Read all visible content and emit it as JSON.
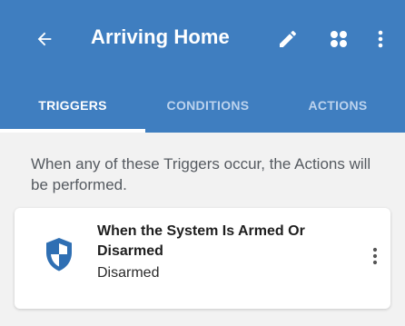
{
  "app_bar": {
    "title": "Arriving Home",
    "icons": [
      "back-arrow-icon",
      "edit-pencil-icon",
      "grid-icon",
      "more-vert-icon"
    ],
    "color": "#3f7ec0"
  },
  "tabs": [
    {
      "label": "TRIGGERS",
      "selected": true
    },
    {
      "label": "CONDITIONS",
      "selected": false
    },
    {
      "label": "ACTIONS",
      "selected": false
    }
  ],
  "description": "When any of these Triggers occur, the Actions will be performed.",
  "trigger_card": {
    "title": "When the System Is Armed Or Disarmed",
    "subtitle": "Disarmed",
    "icon": "shield-icon",
    "icon_color": "#2f6fb3"
  }
}
